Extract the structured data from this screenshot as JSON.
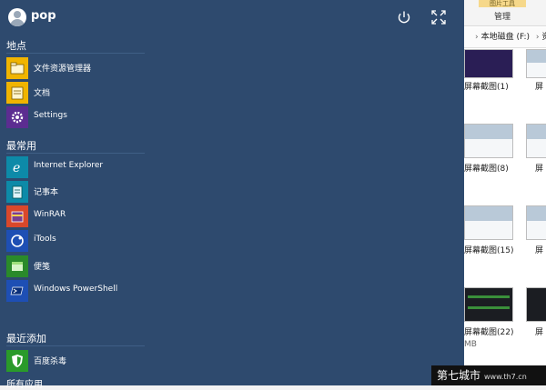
{
  "explorer": {
    "ribbon_top_tab": "图片工具",
    "ribbon_tab": "管理",
    "address": "本地磁盘 (F:)",
    "address_more": "资",
    "captions": [
      "屏幕截图(1)",
      "屏幕截图(8)",
      "屏幕截图(15)",
      "屏幕截图(22)"
    ],
    "size_text": "MB",
    "right_caption": "屏"
  },
  "start": {
    "user": "pop",
    "sections": {
      "places": "地点",
      "most_used": "最常用",
      "recent": "最近添加",
      "all_apps": "所有应用"
    },
    "places": [
      {
        "label": "文件资源管理器",
        "color": "#f0b400",
        "icon": "folder-icon"
      },
      {
        "label": "文档",
        "color": "#f0b400",
        "icon": "document-icon"
      },
      {
        "label": "Settings",
        "color": "#5c2d91",
        "icon": "gear-icon"
      }
    ],
    "most_used": [
      {
        "label": "Internet Explorer",
        "color": "#0d8aa8",
        "icon": "ie-icon"
      },
      {
        "label": "记事本",
        "color": "#0d8aa8",
        "icon": "notepad-icon"
      },
      {
        "label": "WinRAR",
        "color": "#d9482b",
        "icon": "winrar-icon"
      },
      {
        "label": "iTools",
        "color": "#1e4fb4",
        "icon": "itools-icon"
      },
      {
        "label": "便笺",
        "color": "#2a8a2a",
        "icon": "sticky-notes-icon"
      },
      {
        "label": "Windows PowerShell",
        "color": "#1e4fb4",
        "icon": "powershell-icon"
      }
    ],
    "recent": [
      {
        "label": "百度杀毒",
        "color": "#2a9a2a",
        "icon": "antivirus-icon"
      }
    ]
  },
  "watermark": {
    "text": "第七城市",
    "url": "www.th7.cn"
  }
}
